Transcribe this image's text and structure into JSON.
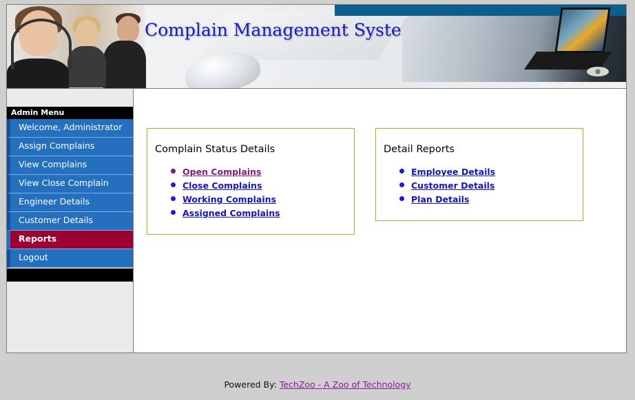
{
  "header": {
    "title": "Complain Management System",
    "accent_color": "#1b1bc8"
  },
  "sidebar": {
    "heading": "Admin Menu",
    "items": [
      {
        "label": "Welcome, Administrator",
        "active": false
      },
      {
        "label": "Assign Complains",
        "active": false
      },
      {
        "label": "View Complains",
        "active": false
      },
      {
        "label": "View Close Complain",
        "active": false
      },
      {
        "label": "Engineer Details",
        "active": false
      },
      {
        "label": "Customer Details",
        "active": false
      },
      {
        "label": "Reports",
        "active": true
      },
      {
        "label": "Logout",
        "active": false
      }
    ],
    "item_color": "#2470bf",
    "active_color": "#9e0035"
  },
  "main": {
    "status_panel": {
      "title": "Complain Status Details",
      "links": [
        {
          "label": "Open Complains",
          "visited": true
        },
        {
          "label": "Close Complains",
          "visited": false
        },
        {
          "label": "Working Complains",
          "visited": false
        },
        {
          "label": "Assigned Complains",
          "visited": false
        }
      ]
    },
    "reports_panel": {
      "title": "Detail Reports",
      "links": [
        {
          "label": "Employee Details",
          "visited": false
        },
        {
          "label": "Customer Details",
          "visited": false
        },
        {
          "label": "Plan Details",
          "visited": false
        }
      ]
    },
    "panel_border_color": "#c8a227"
  },
  "footer": {
    "prefix": "Powered By:",
    "link_label": "TechZoo - A Zoo of Technology"
  }
}
